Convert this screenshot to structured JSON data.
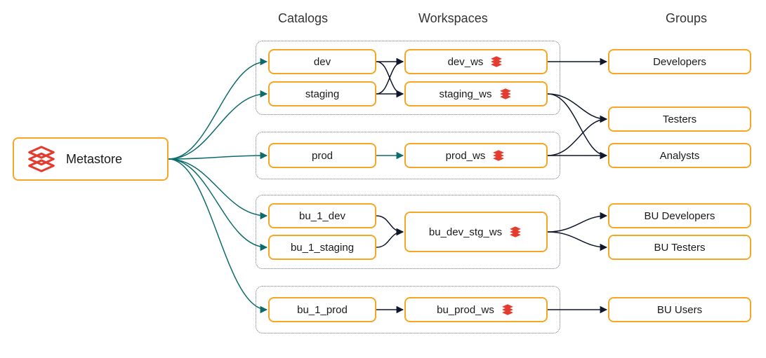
{
  "columns": {
    "catalogs": "Catalogs",
    "workspaces": "Workspaces",
    "groups": "Groups"
  },
  "metastore": {
    "label": "Metastore"
  },
  "catalogs": {
    "dev": "dev",
    "staging": "staging",
    "prod": "prod",
    "bu_1_dev": "bu_1_dev",
    "bu_1_staging": "bu_1_staging",
    "bu_1_prod": "bu_1_prod"
  },
  "workspaces": {
    "dev_ws": "dev_ws",
    "staging_ws": "staging_ws",
    "prod_ws": "prod_ws",
    "bu_dev_stg_ws": "bu_dev_stg_ws",
    "bu_prod_ws": "bu_prod_ws"
  },
  "groups": {
    "developers": "Developers",
    "testers": "Testers",
    "analysts": "Analysts",
    "bu_developers": "BU Developers",
    "bu_testers": "BU Testers",
    "bu_users": "BU Users"
  },
  "colors": {
    "border": "#f5a623",
    "icon_red": "#e33b2e",
    "arrow_dark": "#0f172a",
    "arrow_teal": "#0e6b6b"
  },
  "connections": {
    "metastore_to_catalogs": [
      "dev",
      "staging",
      "prod",
      "bu_1_dev",
      "bu_1_staging",
      "bu_1_prod"
    ],
    "catalog_to_workspace": [
      {
        "from": "dev",
        "to": "dev_ws"
      },
      {
        "from": "dev",
        "to": "staging_ws"
      },
      {
        "from": "staging",
        "to": "dev_ws"
      },
      {
        "from": "staging",
        "to": "staging_ws"
      },
      {
        "from": "prod",
        "to": "prod_ws"
      },
      {
        "from": "bu_1_dev",
        "to": "bu_dev_stg_ws"
      },
      {
        "from": "bu_1_staging",
        "to": "bu_dev_stg_ws"
      },
      {
        "from": "bu_1_prod",
        "to": "bu_prod_ws"
      }
    ],
    "workspace_to_group": [
      {
        "from": "dev_ws",
        "to": "developers"
      },
      {
        "from": "staging_ws",
        "to": "testers"
      },
      {
        "from": "staging_ws",
        "to": "analysts"
      },
      {
        "from": "prod_ws",
        "to": "testers"
      },
      {
        "from": "prod_ws",
        "to": "analysts"
      },
      {
        "from": "bu_dev_stg_ws",
        "to": "bu_developers"
      },
      {
        "from": "bu_dev_stg_ws",
        "to": "bu_testers"
      },
      {
        "from": "bu_prod_ws",
        "to": "bu_users"
      }
    ]
  }
}
